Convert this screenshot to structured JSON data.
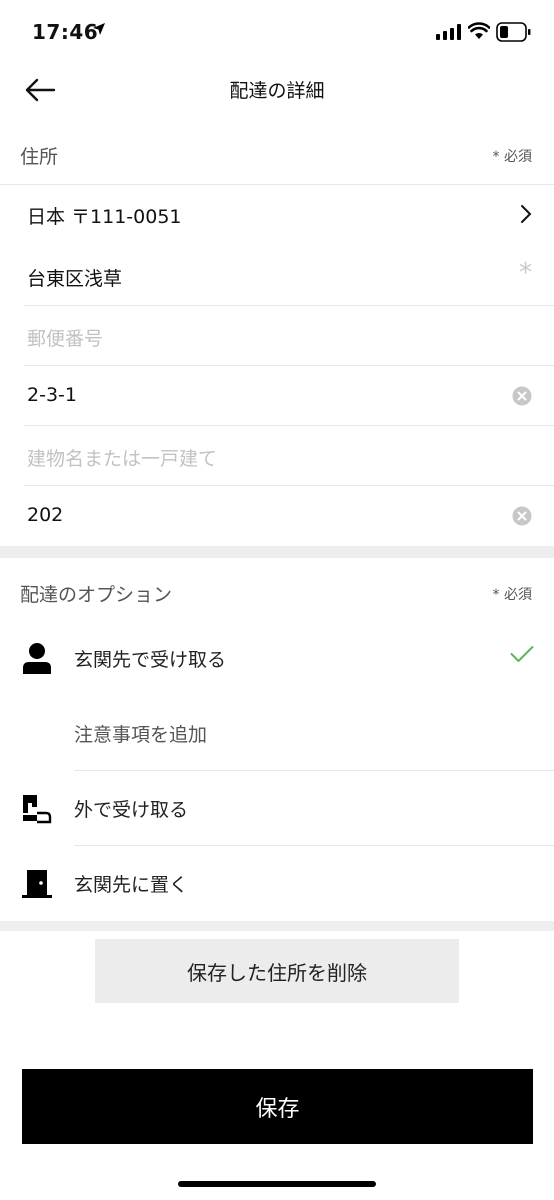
{
  "status_bar": {
    "time": "17:46"
  },
  "nav": {
    "title": "配達の詳細"
  },
  "address_section": {
    "label": "住所",
    "required": "* 必須",
    "country_zip": "日本 〒111-0051",
    "area": "台東区浅草",
    "zip_placeholder": "郵便番号",
    "street": "2-3-1",
    "building_placeholder": "建物名または一戸建て",
    "room": "202"
  },
  "delivery_section": {
    "label": "配達のオプション",
    "required": "* 必須",
    "options": [
      {
        "label": "玄関先で受け取る",
        "icon": "person-icon",
        "selected": true
      },
      {
        "label": "注意事項を追加"
      },
      {
        "label": "外で受け取る",
        "icon": "outside-icon"
      },
      {
        "label": "玄関先に置く",
        "icon": "door-icon"
      }
    ]
  },
  "actions": {
    "delete_label": "保存した住所を削除",
    "save_label": "保存"
  },
  "colors": {
    "check": "#5ab65a",
    "primary": "#000000",
    "gap": "#eeeeee"
  }
}
